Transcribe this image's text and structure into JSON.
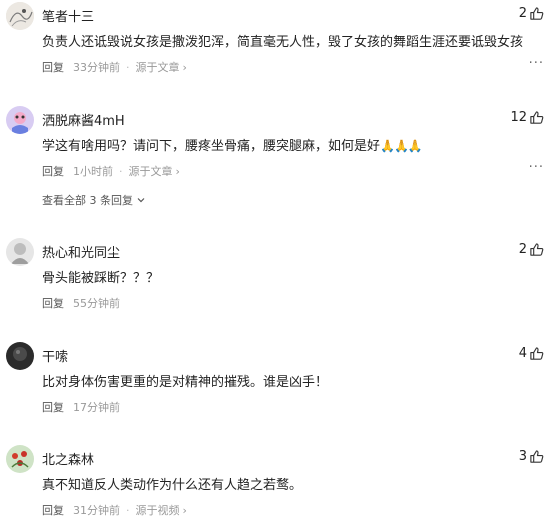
{
  "comments": [
    {
      "username": "笔者十三",
      "likes": "2",
      "text": "负责人还诋毁说女孩是撒泼犯浑，简直毫无人性，毁了女孩的舞蹈生涯还要诋毁女孩",
      "reply_label": "回复",
      "time": "33分钟前",
      "source": "源于文章"
    },
    {
      "username": "洒脱麻酱4mH",
      "likes": "12",
      "text": "学这有啥用吗？请问下，腰疼坐骨痛，腰突腿麻，如何是好",
      "emoji": "🙏🙏🙏",
      "reply_label": "回复",
      "time": "1小时前",
      "source": "源于文章",
      "view_all": "查看全部 3 条回复"
    },
    {
      "username": "热心和光同尘",
      "likes": "2",
      "text": "骨头能被踩断？？？",
      "reply_label": "回复",
      "time": "55分钟前"
    },
    {
      "username": "干嗦",
      "likes": "4",
      "text": "比对身体伤害更重的是对精神的摧残。谁是凶手！",
      "reply_label": "回复",
      "time": "17分钟前"
    },
    {
      "username": "北之森林",
      "likes": "3",
      "text": "真不知道反人类动作为什么还有人趋之若鹜。",
      "reply_label": "回复",
      "time": "31分钟前",
      "source": "源于视频"
    }
  ],
  "more_label": "···"
}
